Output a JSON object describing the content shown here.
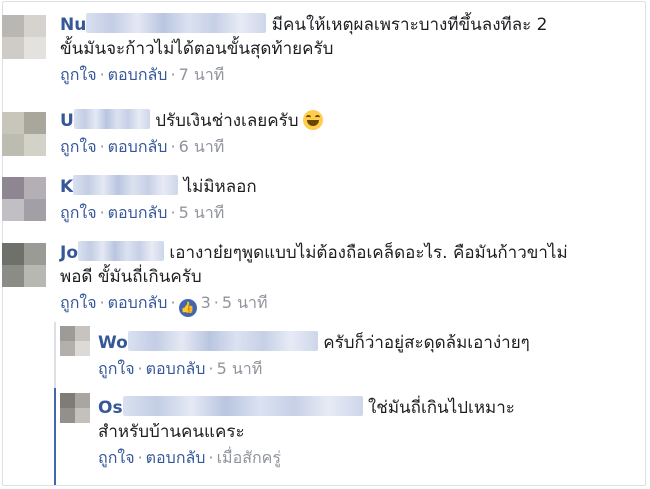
{
  "actions": {
    "like": "ถูกใจ",
    "reply": "ตอบกลับ",
    "sep": "·"
  },
  "comments": [
    {
      "name_prefix": "Nu",
      "text_line1": "มีคนให้เหตุผลเพราะบางทีขึ้นลงทีละ 2",
      "text_line2": "ขั้นมันจะก้าวไม่ได้ตอนขั้นสุดท้ายครับ",
      "time": "7 นาที"
    },
    {
      "name_prefix": "U",
      "text_line1": "ปรับเงินช่างเลยครับ",
      "emoji": "grinning-squinting-face",
      "time": "6 นาที"
    },
    {
      "name_prefix": "K",
      "text_line1": "ไม่มิหลอก",
      "time": "5 นาที"
    },
    {
      "name_prefix": "Jo",
      "text_line1": "เอางาย๋ยๆพูดแบบไม่ต้องถือเคล็ดอะไร. คือมันก้าวขาไม่",
      "text_line2": "พอดี ขั้มันถี่เกินครับ",
      "likes": "3",
      "time": "5 นาที"
    }
  ],
  "replies": [
    {
      "name_prefix": "Wo",
      "text_line1": "ครับก็ว่าอยู่สะดุดล้มเอาง่ายๆ",
      "time": "5 นาที"
    },
    {
      "name_prefix": "Os",
      "text_line1": "ใช่มันถี่เกินไปเหมาะ",
      "text_line2": "สำหรับบ้านคนแคระ",
      "time": "เมื่อสักครู่"
    }
  ]
}
